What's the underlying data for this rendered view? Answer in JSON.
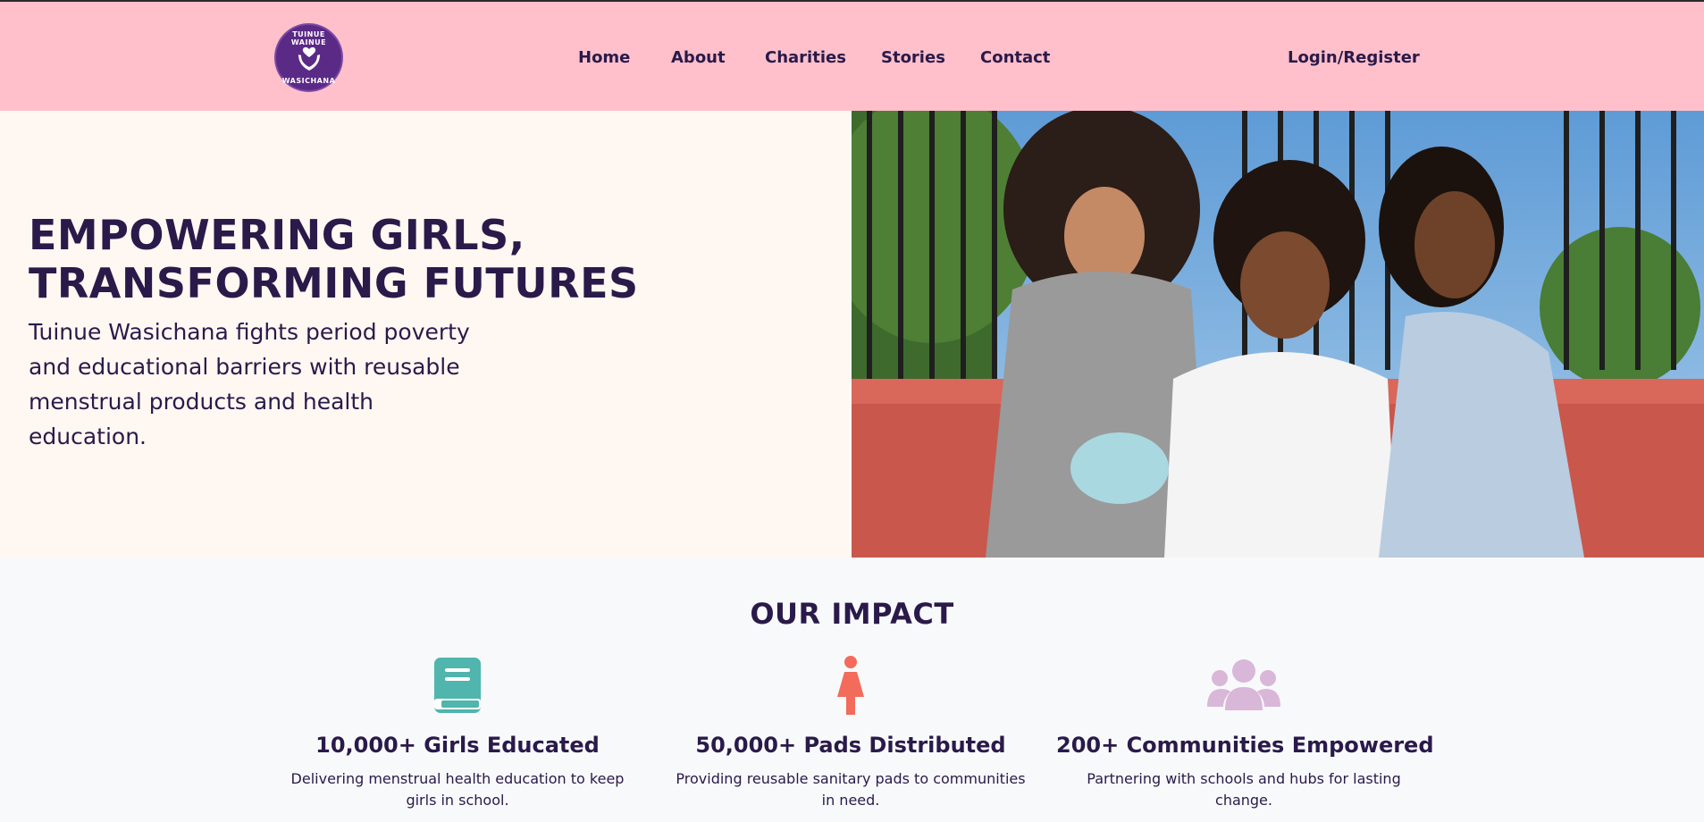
{
  "logo": {
    "top_text": "TUINUE WAINUE",
    "bottom_text": "WASICHANA"
  },
  "nav": {
    "home": "Home",
    "about": "About",
    "charities": "Charities",
    "stories": "Stories",
    "contact": "Contact",
    "login": "Login/Register"
  },
  "hero": {
    "title_line1": "EMPOWERING GIRLS,",
    "title_line2": "TRANSFORMING FUTURES",
    "subtitle": "Tuinue Wasichana fights period poverty and educational barriers with reusable menstrual products and health education."
  },
  "impact": {
    "title": "OUR IMPACT",
    "cards": [
      {
        "icon": "book-icon",
        "stat": "10,000+ Girls Educated",
        "desc": "Delivering menstrual health education to keep girls in school.",
        "color": "#4fb5ad"
      },
      {
        "icon": "female-icon",
        "stat": "50,000+ Pads Distributed",
        "desc": "Providing reusable sanitary pads to communities in need.",
        "color": "#f26b5b"
      },
      {
        "icon": "users-icon",
        "stat": "200+ Communities Empowered",
        "desc": "Partnering with schools and hubs for lasting change.",
        "color": "#d9b7d9"
      }
    ]
  },
  "colors": {
    "nav_bg": "#ffc0cb",
    "text": "#2a1a4a",
    "hero_bg": "#fff8f2",
    "logo_bg": "#5b2a86"
  }
}
